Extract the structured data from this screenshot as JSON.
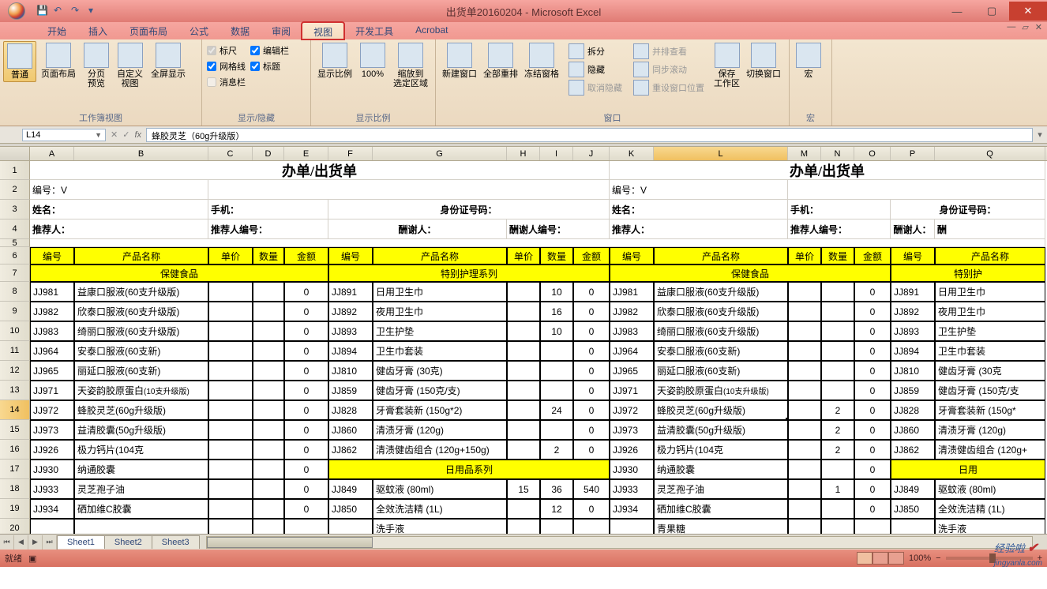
{
  "app": {
    "title": "出货单20160204 - Microsoft Excel"
  },
  "tabs": [
    "开始",
    "插入",
    "页面布局",
    "公式",
    "数据",
    "审阅",
    "视图",
    "开发工具",
    "Acrobat"
  ],
  "active_tab_index": 6,
  "ribbon": {
    "g1": {
      "label": "工作簿视图",
      "btns": [
        "普通",
        "页面布局",
        "分页\n预览",
        "自定义\n视图",
        "全屏显示"
      ]
    },
    "g2": {
      "label": "显示/隐藏",
      "chks": [
        [
          "标尺",
          true
        ],
        [
          "网格线",
          true
        ],
        [
          "消息栏",
          false
        ],
        [
          "编辑栏",
          true
        ],
        [
          "标题",
          true
        ]
      ]
    },
    "g3": {
      "label": "显示比例",
      "btns": [
        "显示比例",
        "100%",
        "缩放到\n选定区域"
      ]
    },
    "g4": {
      "label": "窗口",
      "big": [
        "新建窗口",
        "全部重排",
        "冻结窗格"
      ],
      "small": [
        "拆分",
        "隐藏",
        "取消隐藏",
        "并排查看",
        "同步滚动",
        "重设窗口位置"
      ],
      "right": [
        "保存\n工作区",
        "切换窗口"
      ]
    },
    "g5": {
      "label": "宏",
      "btn": "宏"
    }
  },
  "name_box": "L14",
  "formula": "蜂胶灵芝（60g升级版）",
  "columns": [
    "A",
    "B",
    "C",
    "D",
    "E",
    "F",
    "G",
    "H",
    "I",
    "J",
    "K",
    "L",
    "M",
    "N",
    "O",
    "P",
    "Q"
  ],
  "row_numbers": [
    1,
    2,
    3,
    4,
    5,
    6,
    7,
    8,
    9,
    10,
    11,
    12,
    13,
    14,
    15,
    16,
    17,
    18,
    19,
    20
  ],
  "titles": {
    "left": "办单/出货单",
    "right": "办单/出货单"
  },
  "row2": {
    "a": "编号：V",
    "k": "编号：V"
  },
  "row3": {
    "a": "姓名：",
    "b": "手机：",
    "f": "身份证号码：",
    "k": "姓名：",
    "l": "手机：",
    "p": "身份证号码："
  },
  "row4": {
    "a": "推荐人：",
    "b": "推荐人编号：",
    "f": "酬谢人：",
    "g": "酬谢人编号：",
    "k": "推荐人：",
    "l": "推荐人编号：",
    "p": "酬谢人：",
    "q": "酬"
  },
  "headers": [
    "编号",
    "产品名称",
    "单价",
    "数量",
    "金额"
  ],
  "section1": {
    "a": "保健食品",
    "f": "特别护理系列",
    "k": "保健食品",
    "p": "特别护"
  },
  "section2_g": "日用品系列",
  "section2_p": "日用",
  "data_rows": [
    {
      "a": "JJ981",
      "b": "益康口服液(60支升级版)",
      "e": "0",
      "f": "JJ891",
      "g": "日用卫生巾",
      "h": "",
      "i": "10",
      "j": "0",
      "k": "JJ981",
      "l": "益康口服液(60支升级版)",
      "n": "",
      "o": "0",
      "p": "JJ891",
      "q": "日用卫生巾"
    },
    {
      "a": "JJ982",
      "b": "欣泰口服液(60支升级版)",
      "e": "0",
      "f": "JJ892",
      "g": "夜用卫生巾",
      "h": "",
      "i": "16",
      "j": "0",
      "k": "JJ982",
      "l": "欣泰口服液(60支升级版)",
      "n": "",
      "o": "0",
      "p": "JJ892",
      "q": "夜用卫生巾"
    },
    {
      "a": "JJ983",
      "b": "绮丽口服液(60支升级版)",
      "e": "0",
      "f": "JJ893",
      "g": "卫生护垫",
      "h": "",
      "i": "10",
      "j": "0",
      "k": "JJ983",
      "l": "绮丽口服液(60支升级版)",
      "n": "",
      "o": "0",
      "p": "JJ893",
      "q": "卫生护垫"
    },
    {
      "a": "JJ964",
      "b": "安泰口服液(60支新)",
      "e": "0",
      "f": "JJ894",
      "g": "卫生巾套装",
      "h": "",
      "i": "",
      "j": "0",
      "k": "JJ964",
      "l": "安泰口服液(60支新)",
      "n": "",
      "o": "0",
      "p": "JJ894",
      "q": "卫生巾套装"
    },
    {
      "a": "JJ965",
      "b": "丽延口服液(60支新)",
      "e": "0",
      "f": "JJ810",
      "g": "健齿牙膏 (30克)",
      "h": "",
      "i": "",
      "j": "0",
      "k": "JJ965",
      "l": "丽延口服液(60支新)",
      "n": "",
      "o": "0",
      "p": "JJ810",
      "q": "健齿牙膏 (30克"
    },
    {
      "a": "JJ971",
      "b": "天姿韵胶原蛋白",
      "bs": "(10支升级版)",
      "e": "0",
      "f": "JJ859",
      "g": "健齿牙膏 (150克/支)",
      "h": "",
      "i": "",
      "j": "0",
      "k": "JJ971",
      "l": "天姿韵胶原蛋白",
      "ls": "(10支升级版)",
      "n": "",
      "o": "0",
      "p": "JJ859",
      "q": "健齿牙膏 (150克/支"
    },
    {
      "a": "JJ972",
      "b": "蜂胶灵芝(60g升级版)",
      "e": "0",
      "f": "JJ828",
      "g": "牙膏套装新 (150g*2)",
      "h": "",
      "i": "24",
      "j": "0",
      "k": "JJ972",
      "l": "蜂胶灵芝(60g升级版)",
      "n": "2",
      "o": "0",
      "p": "JJ828",
      "q": "牙膏套装新 (150g*"
    },
    {
      "a": "JJ973",
      "b": "益清胶囊(50g升级版)",
      "e": "0",
      "f": "JJ860",
      "g": "清渍牙膏 (120g)",
      "h": "",
      "i": "",
      "j": "0",
      "k": "JJ973",
      "l": "益清胶囊(50g升级版)",
      "n": "2",
      "o": "0",
      "p": "JJ860",
      "q": "清渍牙膏 (120g)"
    },
    {
      "a": "JJ926",
      "b": "极力钙片(104克",
      "e": "0",
      "f": "JJ862",
      "g": "清渍健齿组合 (120g+150g)",
      "h": "",
      "i": "2",
      "j": "0",
      "k": "JJ926",
      "l": "极力钙片(104克",
      "n": "2",
      "o": "0",
      "p": "JJ862",
      "q": "清渍健齿组合 (120g+"
    },
    {
      "a": "JJ930",
      "b": "纳通胶囊",
      "e": "0",
      "f": "",
      "g": "",
      "h": "",
      "i": "",
      "j": "",
      "k": "JJ930",
      "l": "纳通胶囊",
      "n": "",
      "o": "0",
      "p": "",
      "q": ""
    },
    {
      "a": "JJ933",
      "b": "灵芝孢子油",
      "e": "0",
      "f": "JJ849",
      "g": "驱蚊液 (80ml)",
      "h": "15",
      "i": "36",
      "j": "540",
      "k": "JJ933",
      "l": "灵芝孢子油",
      "n": "1",
      "o": "0",
      "p": "JJ849",
      "q": "驱蚊液 (80ml)"
    },
    {
      "a": "JJ934",
      "b": "硒加维C胶囊",
      "e": "0",
      "f": "JJ850",
      "g": "全效洗洁精 (1L)",
      "h": "",
      "i": "12",
      "j": "0",
      "k": "JJ934",
      "l": "硒加维C胶囊",
      "n": "",
      "o": "0",
      "p": "JJ850",
      "q": "全效洗洁精 (1L)"
    },
    {
      "a": "",
      "b": "",
      "e": "",
      "f": "",
      "g": "洗手液",
      "h": "",
      "i": "",
      "j": "",
      "k": "",
      "l": "青果糖",
      "n": "",
      "o": "",
      "p": "",
      "q": "洗手液"
    }
  ],
  "sheets": [
    "Sheet1",
    "Sheet2",
    "Sheet3"
  ],
  "status": {
    "ready": "就绪",
    "zoom": "100%"
  },
  "watermark": "jingyanla.com"
}
